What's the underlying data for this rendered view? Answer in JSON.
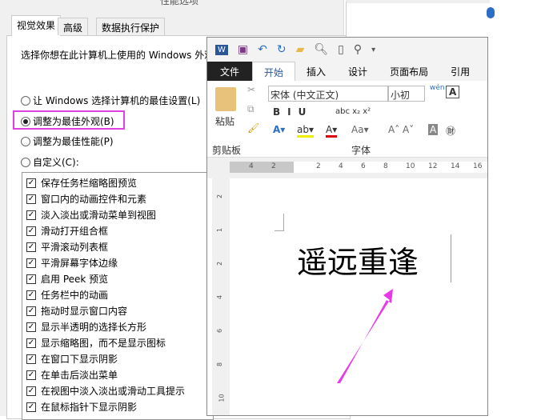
{
  "dialog": {
    "title": "性能选项",
    "tabs": [
      "视觉效果",
      "高级",
      "数据执行保护"
    ],
    "description": "选择你想在此计算机上使用的 Windows 外观",
    "radios": [
      {
        "label": "让 Windows 选择计算机的最佳设置(L)",
        "checked": false
      },
      {
        "label": "调整为最佳外观(B)",
        "checked": true
      },
      {
        "label": "调整为最佳性能(P)",
        "checked": false
      },
      {
        "label": "自定义(C):",
        "checked": false
      }
    ],
    "checkboxes": [
      "保存任务栏缩略图预览",
      "窗口内的动画控件和元素",
      "淡入淡出或滑动菜单到视图",
      "滑动打开组合框",
      "平滑滚动列表框",
      "平滑屏幕字体边缘",
      "启用 Peek 预览",
      "任务栏中的动画",
      "拖动时显示窗口内容",
      "显示半透明的选择长方形",
      "显示缩略图，而不是显示图标",
      "在窗口下显示阴影",
      "在单击后淡出菜单",
      "在视图中淡入淡出或滑动工具提示",
      "在鼠标指针下显示阴影"
    ],
    "highlight_color": "#e040e0"
  },
  "word": {
    "tabs": [
      "文件",
      "开始",
      "插入",
      "设计",
      "页面布局",
      "引用"
    ],
    "active_tab": "开始",
    "font_name": "宋体 (中文正文)",
    "font_size": "小初",
    "paste": "粘贴",
    "clipboard_group": "剪贴板",
    "font_group": "字体",
    "ruler_ticks": [
      "4",
      "2",
      "2",
      "4",
      "6",
      "8",
      "10",
      "12",
      "14",
      "16"
    ],
    "vruler_ticks": [
      "2",
      "1",
      "2",
      "4",
      "6",
      "8",
      "10"
    ],
    "doc_text": "遥远重逢",
    "arrow_color": "#e838e8"
  }
}
